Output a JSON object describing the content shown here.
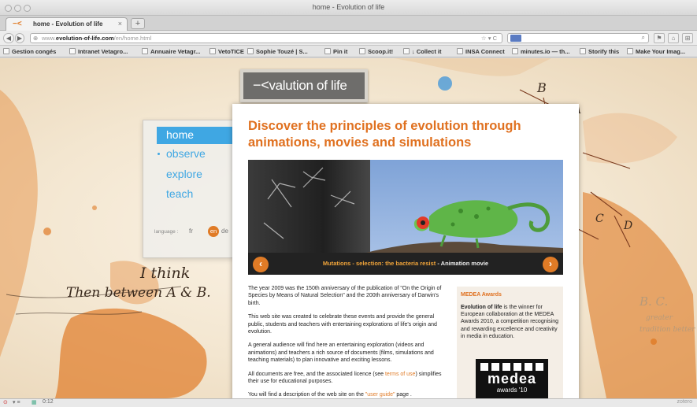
{
  "window": {
    "title": "home - Evolution of life"
  },
  "tab": {
    "label": "home - Evolution of life",
    "close": "×",
    "new": "+"
  },
  "urlbar": {
    "prefix": "www.",
    "domain": "evolution-of-life.com",
    "path": "/en/home.html"
  },
  "bookmarks": [
    "Gestion congés",
    "Intranet Vetagro...",
    "Annuaire Vetagr...",
    "VetoTICE",
    "Sophie Touzé | S...",
    "Pin it",
    "Scoop.it!",
    "↓ Collect it",
    "INSA Connect",
    "minutes.io — th...",
    "Storify this",
    "Make Your Imag..."
  ],
  "site": {
    "logo": "valution of life",
    "nav": {
      "home": "home",
      "observe": "observe",
      "explore": "explore",
      "teach": "teach"
    },
    "language": {
      "label": "language :",
      "fr": "fr",
      "en": "en",
      "de": "de"
    },
    "headline": "Discover the principles of evolution through animations, movies and simulations",
    "hero": {
      "caption": "Mutations - selection: the bacteria resist",
      "caption_suffix": " - Animation movie",
      "prev": "‹",
      "next": "›"
    },
    "paragraphs": [
      "The year 2009 was the 150th anniversary of the publication of \"On the Origin of Species by Means of Natural Selection\" and the 200th anniversary of Darwin's birth.",
      "This web site was created to celebrate these events and provide the general public, students and teachers with entertaining explorations of life's origin and evolution.",
      "A general audience will find here an entertaining exploration (videos and animations) and teachers a rich source of documents (films, simulations and teaching materials) to plan innovative and exciting lessons."
    ],
    "licence": {
      "before": "All documents are free, and the associated licence (see ",
      "link": "terms of use",
      "after": ") simplifies their use for educational purposes."
    },
    "guide": {
      "before": "You will find a description of the web site on the ",
      "link": "\"user guide\"",
      "after": " page ."
    },
    "awards": {
      "title": "MEDEA Awards",
      "bold": "Evolution of life",
      "text": " is the winner for European collaboration at the MEDEA Awards 2010, a competition recognising and rewarding excellence and creativity in media in education.",
      "badge_word": "medea",
      "badge_sub": "awards '10"
    },
    "sketch": {
      "line1": "I think",
      "line2": "Then between A & B.",
      "letter_b": "B",
      "letter_a": "A",
      "letter_c": "C",
      "letter_d": "D",
      "right_note": "B. C.",
      "right_small1": "greater",
      "right_small2": "tradition better"
    }
  },
  "status": {
    "time": "0:12",
    "right": "zotero"
  },
  "colors": {
    "accent": "#e07120",
    "nav": "#3fa7e3"
  }
}
